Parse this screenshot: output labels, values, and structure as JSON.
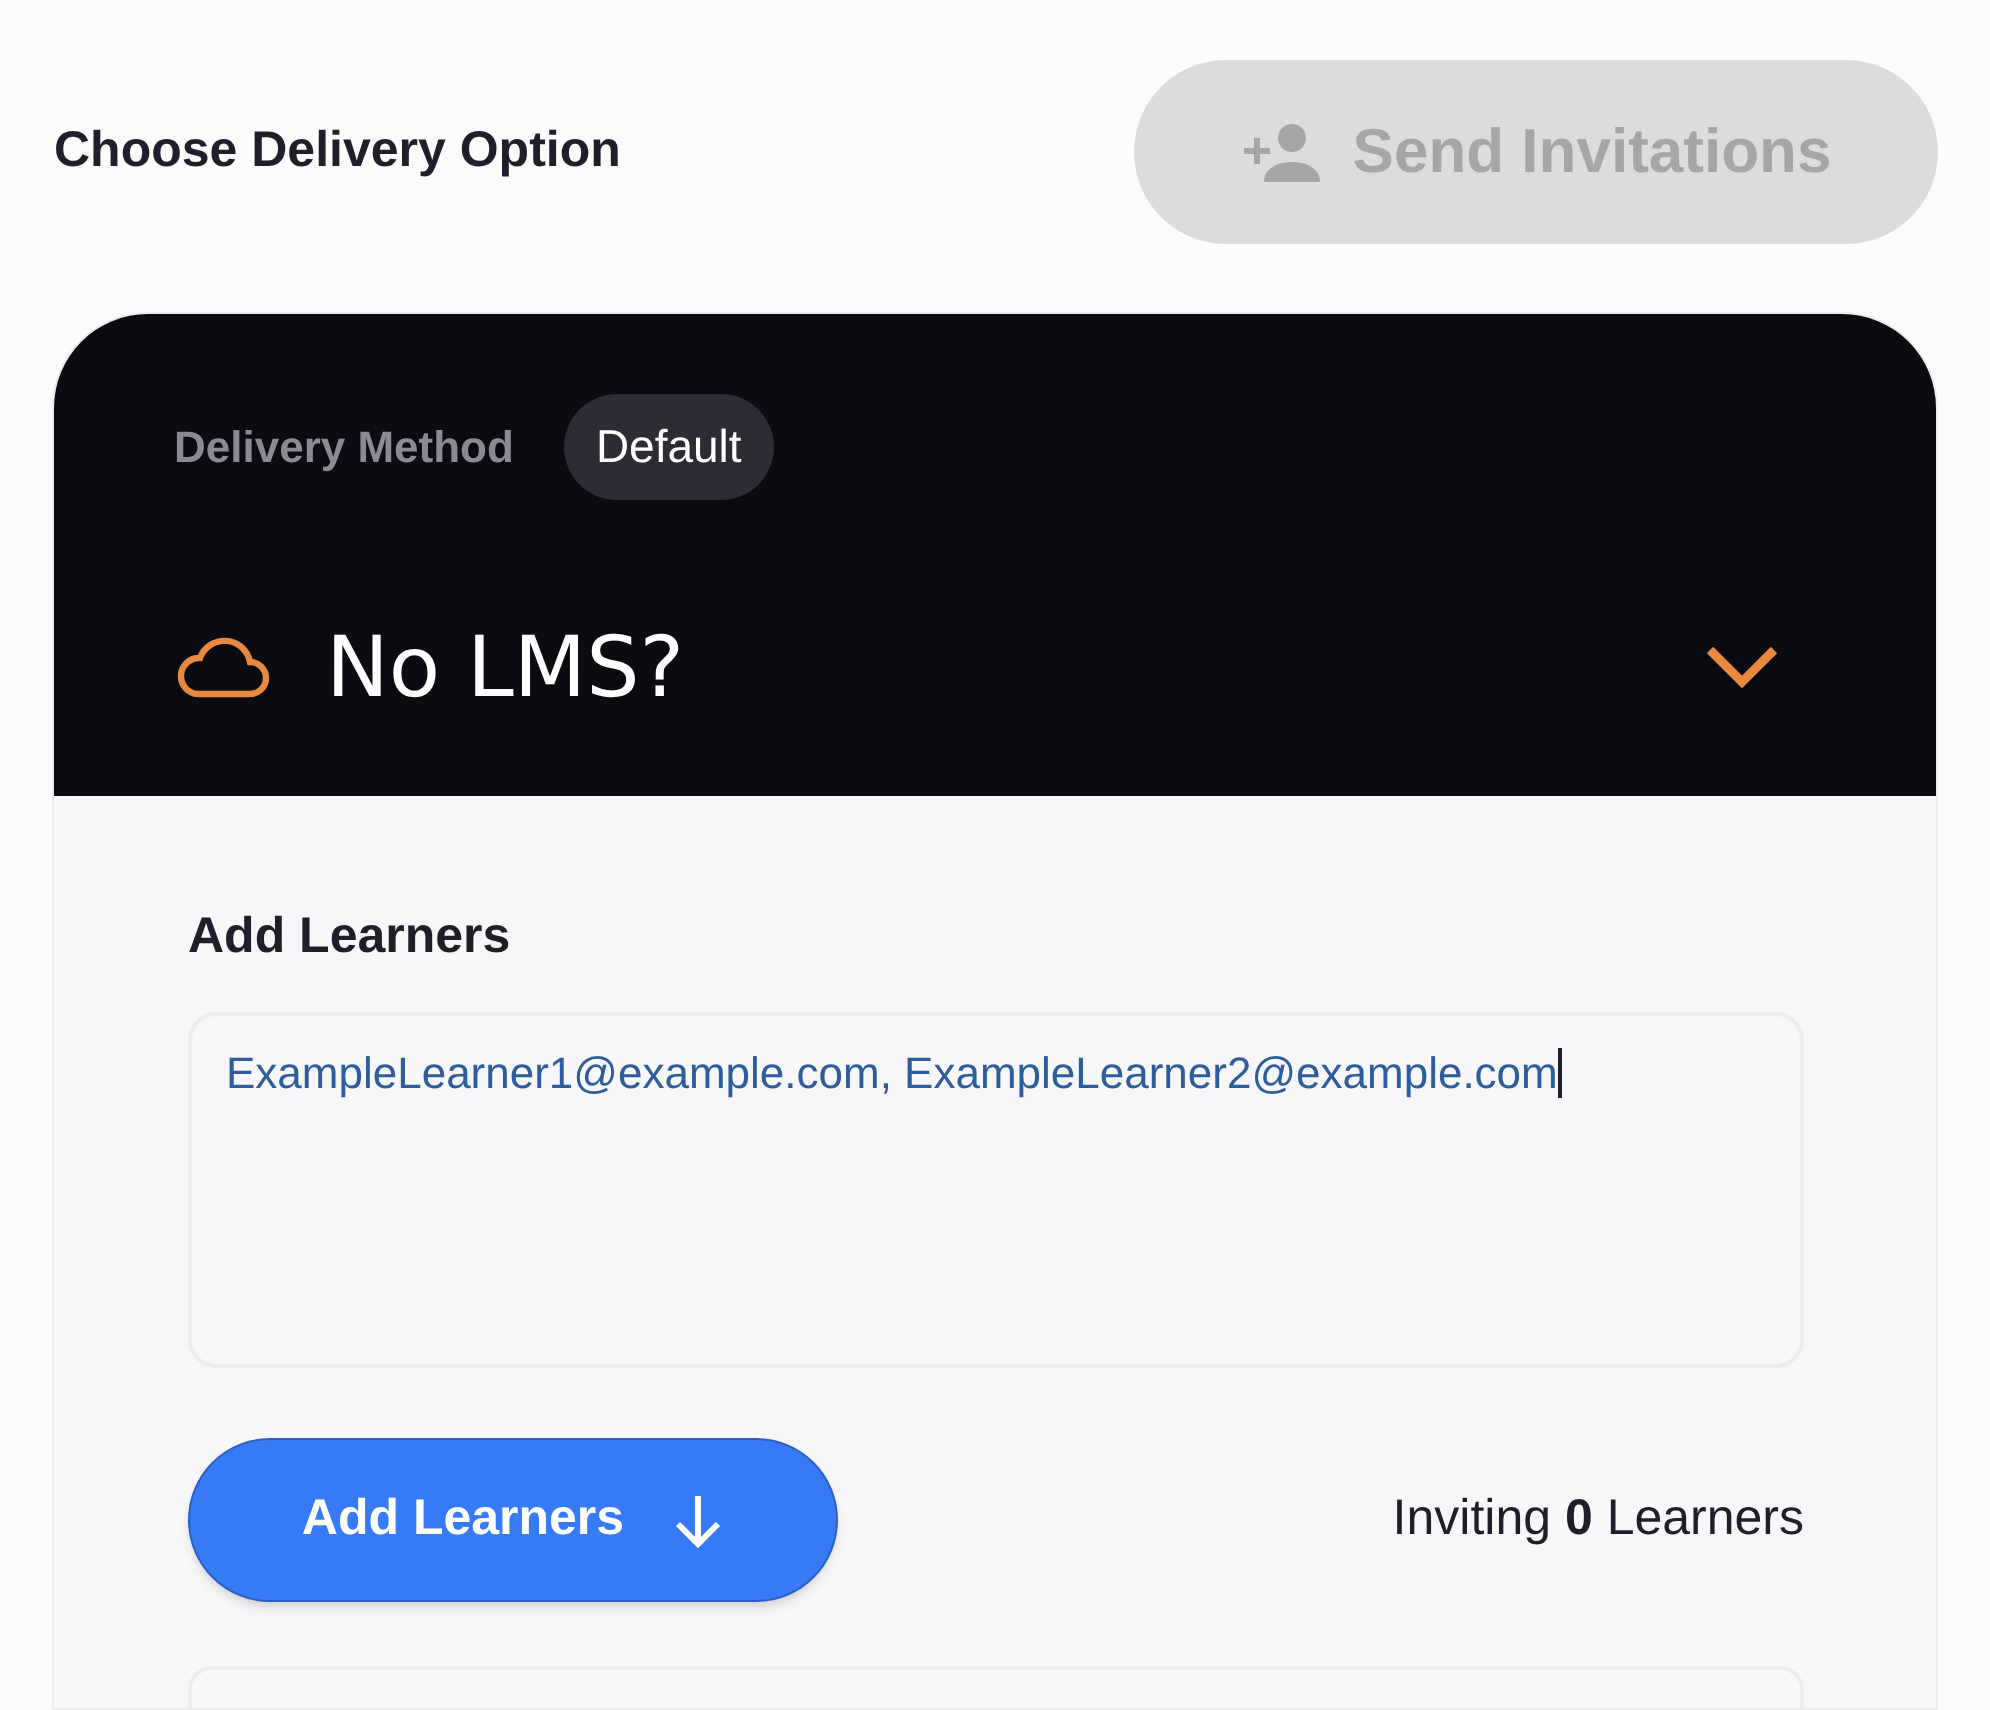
{
  "header": {
    "title": "Choose Delivery Option"
  },
  "send_button": {
    "label": "Send Invitations",
    "disabled": true
  },
  "delivery": {
    "label": "Delivery Method",
    "badge": "Default",
    "option": "No LMS?",
    "expanded": false
  },
  "learners": {
    "label": "Add Learners",
    "value": "ExampleLearner1@example.com, ExampleLearner2@example.com",
    "button": "Add Learners",
    "summary": "Inviting **0** Learners"
  }
}
